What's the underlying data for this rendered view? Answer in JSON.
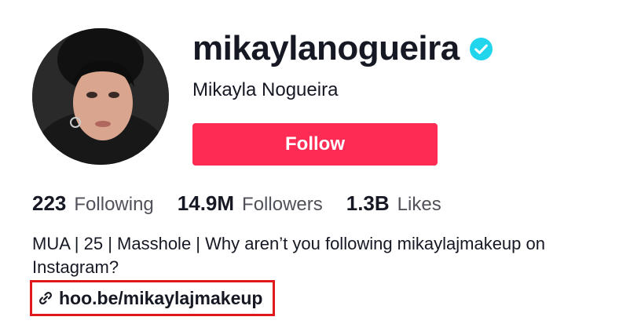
{
  "profile": {
    "username": "mikaylanogueira",
    "nickname": "Mikayla Nogueira",
    "verified": true,
    "follow_label": "Follow",
    "bio": "MUA | 25 | Masshole | Why aren’t you following mikaylajmakeup on Instagram?",
    "link": "hoo.be/mikaylajmakeup"
  },
  "stats": [
    {
      "value": "223",
      "label": "Following"
    },
    {
      "value": "14.9M",
      "label": "Followers"
    },
    {
      "value": "1.3B",
      "label": "Likes"
    }
  ],
  "colors": {
    "follow_button": "#fe2c55",
    "verified_badge": "#20d5ec",
    "highlight_box": "#e0191e"
  },
  "icons": {
    "verified": "verified-check-icon",
    "link": "link-icon"
  }
}
